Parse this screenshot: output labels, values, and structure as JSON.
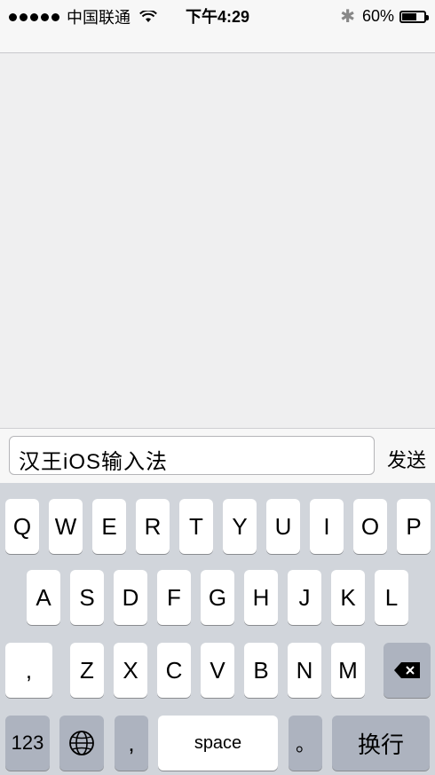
{
  "status": {
    "carrier": "中国联通",
    "time": "下午4:29",
    "battery": "60%"
  },
  "input": {
    "text": "汉王iOS输入法",
    "send_label": "发送"
  },
  "keyboard": {
    "row1": [
      "Q",
      "W",
      "E",
      "R",
      "T",
      "Y",
      "U",
      "I",
      "O",
      "P"
    ],
    "row2": [
      "A",
      "S",
      "D",
      "F",
      "G",
      "H",
      "J",
      "K",
      "L"
    ],
    "row3": [
      ",",
      "Z",
      "X",
      "C",
      "V",
      "B",
      "N",
      "M"
    ],
    "bottom": {
      "numbers": "123",
      "comma": ",",
      "space": "space",
      "period": "。",
      "return": "换行"
    }
  }
}
